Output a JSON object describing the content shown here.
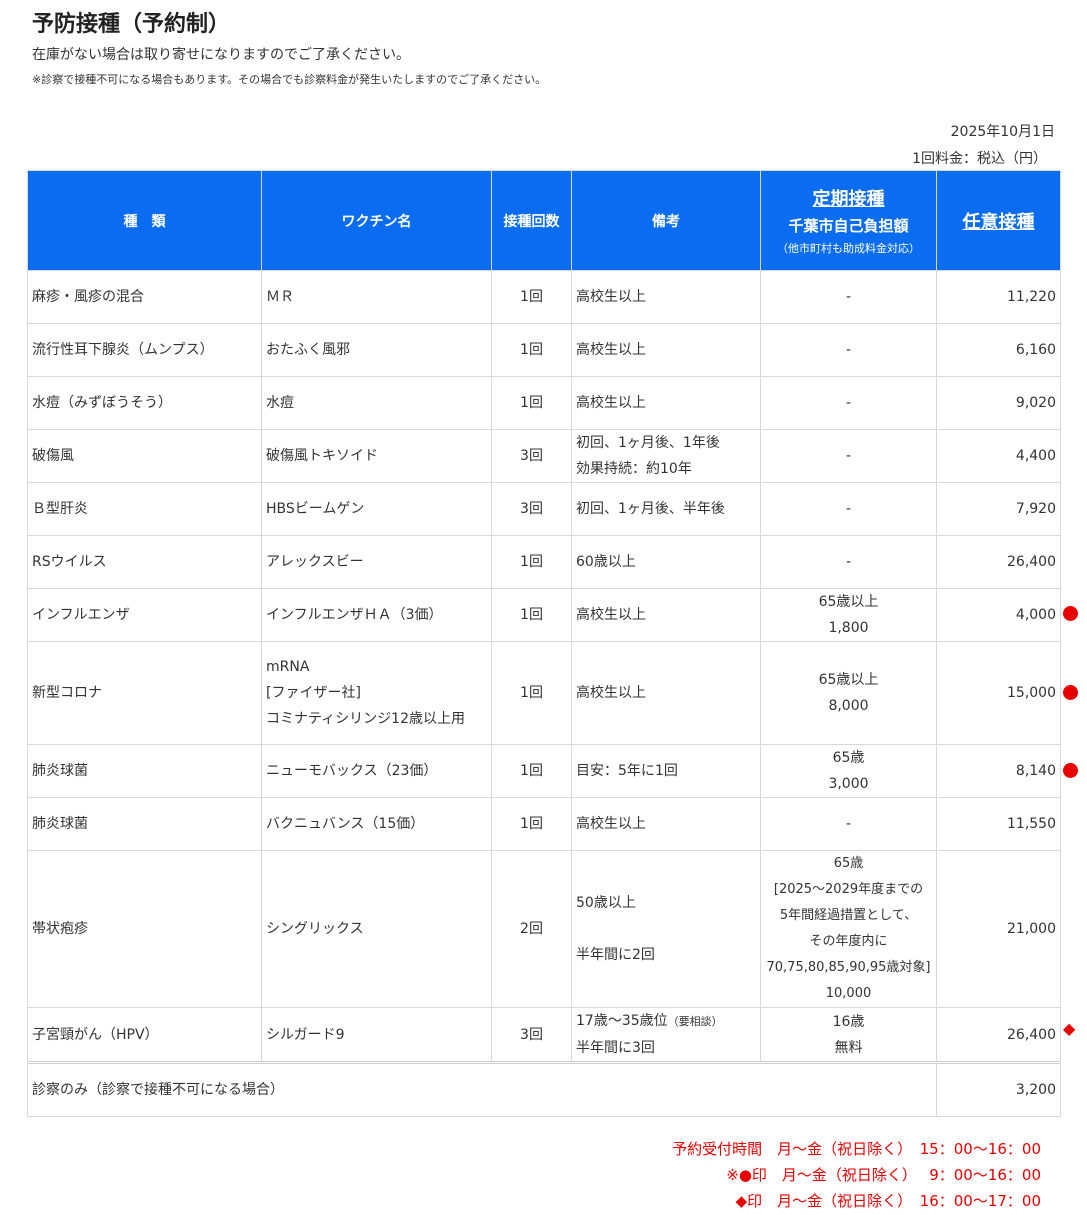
{
  "header": {
    "title": "予防接種（予約制）",
    "note1": "在庫がない場合は取り寄せになりますのでご了承ください。",
    "note2": "※診察で接種不可になる場合もあります。その場合でも診察料金が発生いたしますのでご了承ください。",
    "date": "2025年10月1日",
    "price_unit": "1回料金：税込（円）"
  },
  "table": {
    "headers": {
      "kind": "種　類",
      "vaccine": "ワクチン名",
      "doses": "接種回数",
      "remarks": "備考",
      "routine_title": "定期接種",
      "routine_sub": "千葉市自己負担額",
      "routine_note": "（他市町村も助成料金対応）",
      "voluntary": "任意接種"
    },
    "rows": [
      {
        "kind": "麻疹・風疹の混合",
        "vaccine": "ＭＲ",
        "doses": "1回",
        "remarks": "高校生以上",
        "routine": "-",
        "price": "11,220"
      },
      {
        "kind": "流行性耳下腺炎（ムンプス）",
        "vaccine": "おたふく風邪",
        "doses": "1回",
        "remarks": "高校生以上",
        "routine": "-",
        "price": "6,160"
      },
      {
        "kind": "水痘（みずぼうそう）",
        "vaccine": "水痘",
        "doses": "1回",
        "remarks": "高校生以上",
        "routine": "-",
        "price": "9,020"
      },
      {
        "kind": "破傷風",
        "vaccine": "破傷風トキソイド",
        "doses": "3回",
        "remarks": "初回、1ヶ月後、1年後\n効果持続：約10年",
        "routine": "-",
        "price": "4,400"
      },
      {
        "kind": "Ｂ型肝炎",
        "vaccine": "HBSビームゲン",
        "doses": "3回",
        "remarks": "初回、1ヶ月後、半年後",
        "routine": "-",
        "price": "7,920"
      },
      {
        "kind": "RSウイルス",
        "vaccine": "アレックスビー",
        "doses": "1回",
        "remarks": "60歳以上",
        "routine": "-",
        "price": "26,400"
      },
      {
        "kind": "インフルエンザ",
        "vaccine": "インフルエンザＨＡ（3価）",
        "doses": "1回",
        "remarks": "高校生以上",
        "routine": "65歳以上\n1,800",
        "price": "4,000"
      },
      {
        "kind": "新型コロナ",
        "vaccine": "mRNA\n[ファイザー社]\nコミナティシリンジ12歳以上用",
        "doses": "1回",
        "remarks": "高校生以上",
        "routine": "65歳以上\n8,000",
        "price": "15,000"
      },
      {
        "kind": "肺炎球菌",
        "vaccine": "ニューモバックス（23価）",
        "doses": "1回",
        "remarks": "目安：5年に1回",
        "routine": "65歳\n3,000",
        "price": "8,140"
      },
      {
        "kind": "肺炎球菌",
        "vaccine": "バクニュバンス（15価）",
        "doses": "1回",
        "remarks": "高校生以上",
        "routine": "-",
        "price": "11,550"
      },
      {
        "kind": "帯状疱疹",
        "vaccine": "シングリックス",
        "doses": "2回",
        "remarks": "50歳以上\n\n半年間に2回",
        "routine": "65歳\n[2025～2029年度までの\n5年間経過措置として、\nその年度内に\n70,75,80,85,90,95歳対象]\n10,000",
        "price": "21,000"
      },
      {
        "kind": "子宮頸がん（HPV）",
        "vaccine": "シルガード9",
        "doses": "3回",
        "remarks": "17歳～35歳位",
        "remarks_small": "（要相談）",
        "remarks2": "半年間に3回",
        "routine": "16歳\n無料",
        "price": "26,400"
      }
    ],
    "exam": {
      "label": "診察のみ（診察で接種不可になる場合）",
      "price": "3,200"
    }
  },
  "marks": {
    "dot": "●",
    "diamond": "◆"
  },
  "footer": {
    "line1": "予約受付時間　月～金（祝日除く）　15：00～16：00",
    "line2": "※●印　月～金（祝日除く）　 9：00～16：00",
    "line3": "◆印　月～金（祝日除く）　16：00～17：00"
  },
  "colors": {
    "header_bg": "#0a6cf0",
    "accent_red": "#e60000"
  }
}
